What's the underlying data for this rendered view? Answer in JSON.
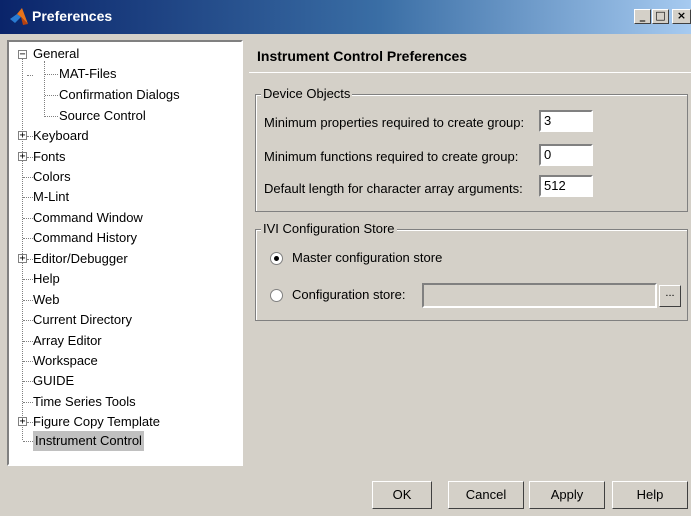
{
  "window": {
    "title": "Preferences",
    "minimize": "_",
    "maximize": "□",
    "close": "×"
  },
  "tree": {
    "items": [
      {
        "label": "General",
        "expanded": true,
        "expander": "−"
      },
      {
        "label": "MAT-Files"
      },
      {
        "label": "Confirmation Dialogs"
      },
      {
        "label": "Source Control"
      },
      {
        "label": "Keyboard",
        "expander": "+"
      },
      {
        "label": "Fonts",
        "expander": "+"
      },
      {
        "label": "Colors"
      },
      {
        "label": "M-Lint"
      },
      {
        "label": "Command Window"
      },
      {
        "label": "Command History"
      },
      {
        "label": "Editor/Debugger",
        "expander": "+"
      },
      {
        "label": "Help"
      },
      {
        "label": "Web"
      },
      {
        "label": "Current Directory"
      },
      {
        "label": "Array Editor"
      },
      {
        "label": "Workspace"
      },
      {
        "label": "GUIDE"
      },
      {
        "label": "Time Series Tools"
      },
      {
        "label": "Figure Copy Template",
        "expander": "+"
      },
      {
        "label": "Instrument Control",
        "selected": true
      }
    ]
  },
  "panel": {
    "title": "Instrument Control Preferences",
    "device_objects": {
      "legend": "Device Objects",
      "min_properties_label": "Minimum properties required to create group:",
      "min_properties_value": "3",
      "min_functions_label": "Minimum functions required to create group:",
      "min_functions_value": "0",
      "default_length_label": "Default length for character array arguments:",
      "default_length_value": "512"
    },
    "ivi": {
      "legend": "IVI Configuration Store",
      "master_label": "Master configuration store",
      "config_label": "Configuration store:",
      "config_value": "",
      "browse_label": "..."
    }
  },
  "buttons": {
    "ok": "OK",
    "cancel": "Cancel",
    "apply": "Apply",
    "help": "Help"
  }
}
